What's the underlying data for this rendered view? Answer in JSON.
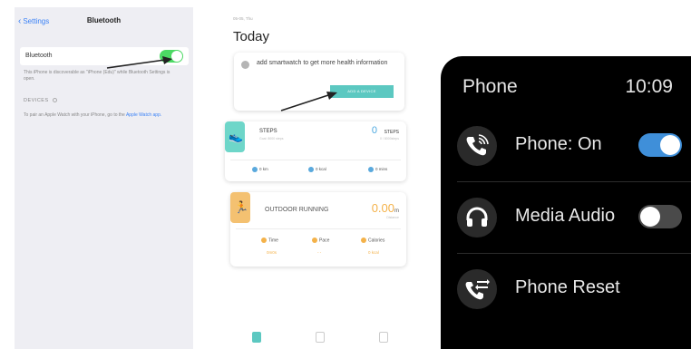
{
  "ios_settings": {
    "back_label": "Settings",
    "title": "Bluetooth",
    "bluetooth_row_label": "Bluetooth",
    "bluetooth_on": true,
    "discoverable_note": "This iPhone is discoverable as \"iPhone (Edu)\" while Bluetooth Settings is open.",
    "devices_header": "DEVICES",
    "pair_note": "To pair an Apple Watch with your iPhone, go to the",
    "pair_link": "Apple Watch app."
  },
  "health_app": {
    "date": "05-05, Thu",
    "title": "Today",
    "add_prompt": "add smartwatch to get more health information",
    "add_button": "ADD A DEVICE",
    "steps": {
      "title": "STEPS",
      "subtitle": "Goal: 8000 steps",
      "value": "0",
      "unit": "STEPS",
      "sub_value": "0 / 8000steps",
      "stat1": "0 km",
      "stat2": "0 kcal",
      "stat3": "0 mins"
    },
    "running": {
      "title": "OUTDOOR RUNNING",
      "value": "0.00",
      "unit": "m",
      "sub_value": "Distance",
      "stat1_label": "Time",
      "stat2_label": "Pace",
      "stat3_label": "Calories",
      "stat1_value": "0m0s",
      "stat2_value": "- -",
      "stat3_value": "0 kcal"
    }
  },
  "watch": {
    "title": "Phone",
    "time": "10:09",
    "items": [
      {
        "label": "Phone: On",
        "icon": "phone-call-icon",
        "toggle": "on"
      },
      {
        "label": "Media Audio",
        "icon": "headphones-icon",
        "toggle": "off"
      },
      {
        "label": "Phone Reset",
        "icon": "phone-reset-icon"
      }
    ],
    "colors": {
      "toggle_on": "#3f8fd9",
      "background": "#000000"
    }
  },
  "colors": {
    "ios_toggle": "#4cd964",
    "app_accent": "#5cc8c1",
    "steps_badge": "#6ed6c9",
    "running_badge": "#f4c171"
  }
}
